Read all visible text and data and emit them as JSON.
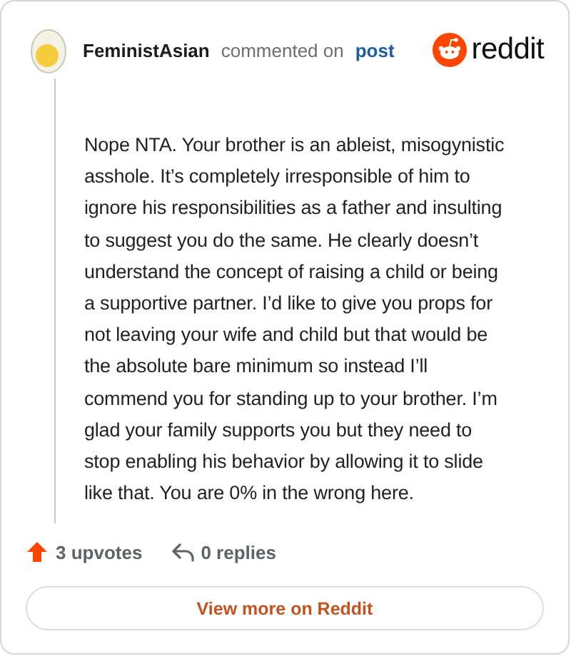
{
  "header": {
    "author": "FeministAsian",
    "action": "commented on",
    "link": "post",
    "brand": "reddit"
  },
  "comment": "Nope NTA. Your brother is an ableist, misogynistic asshole. It’s completely irresponsible of him to ignore his responsibilities as a father and insulting to suggest you do the same. He clearly doesn’t understand the concept of raising a child or being a supportive partner. I’d like to give you props for not leaving your wife and child but that would be the absolute bare minimum so instead I’ll commend you for standing up to your brother. I’m glad your family supports you but they need to stop enabling his behavior by allowing it to slide like that. You are 0% in the wrong here.",
  "stats": [
    {
      "kind": "upvotes",
      "label": "3 upvotes"
    },
    {
      "kind": "replies",
      "label": "0 replies"
    }
  ],
  "button": "View more on Reddit"
}
